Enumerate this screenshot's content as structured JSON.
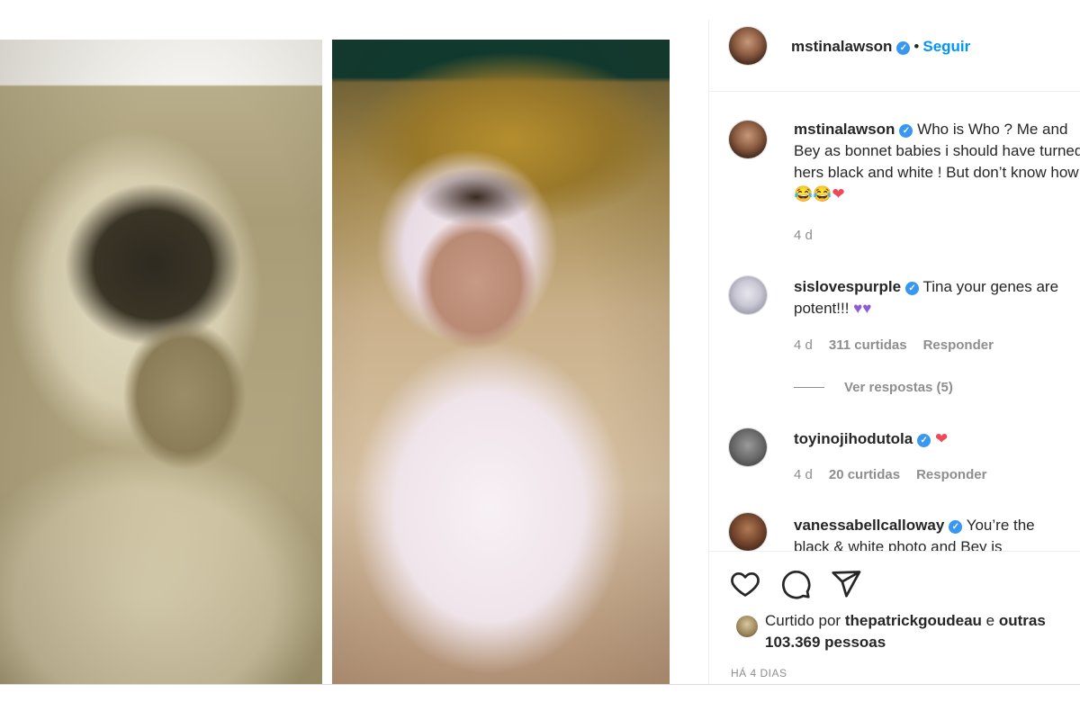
{
  "post": {
    "author": "mstinalawson",
    "follow_label": "Seguir",
    "separator": "•"
  },
  "comments": [
    {
      "username": "mstinalawson",
      "text": "Who is Who ? Me and Bey as bonnet babies i should have turned hers black and white ! But don’t know how",
      "emojis": "😂😂",
      "time": "4 d",
      "verified": true
    },
    {
      "username": "sislovespurple",
      "text": "Tina your genes are potent!!!",
      "time": "4 d",
      "likes": "311 curtidas",
      "reply_label": "Responder",
      "view_replies": "Ver respostas (5)",
      "verified": true
    },
    {
      "username": "toyinojihodutola",
      "text": "",
      "time": "4 d",
      "likes": "20 curtidas",
      "reply_label": "Responder",
      "verified": true
    },
    {
      "username": "vanessabellcalloway",
      "text": "You’re the black & white photo and Bey is",
      "verified": true
    }
  ],
  "likes": {
    "prefix": "Curtido por",
    "user": "thepatrickgoudeau",
    "conjunction": "e",
    "others": "outras 103.369 pessoas"
  },
  "timestamp": "HÁ 4 DIAS",
  "icons": {
    "like": "heart-outline-icon",
    "comment": "comment-bubble-icon",
    "share": "paper-plane-icon",
    "verified": "verified-badge-icon"
  },
  "colors": {
    "accent": "#0095f6",
    "verified": "#3897f0",
    "heart_red": "#ed4956",
    "heart_purple": "#8a5cd6",
    "muted_text": "#8e8e8e"
  }
}
